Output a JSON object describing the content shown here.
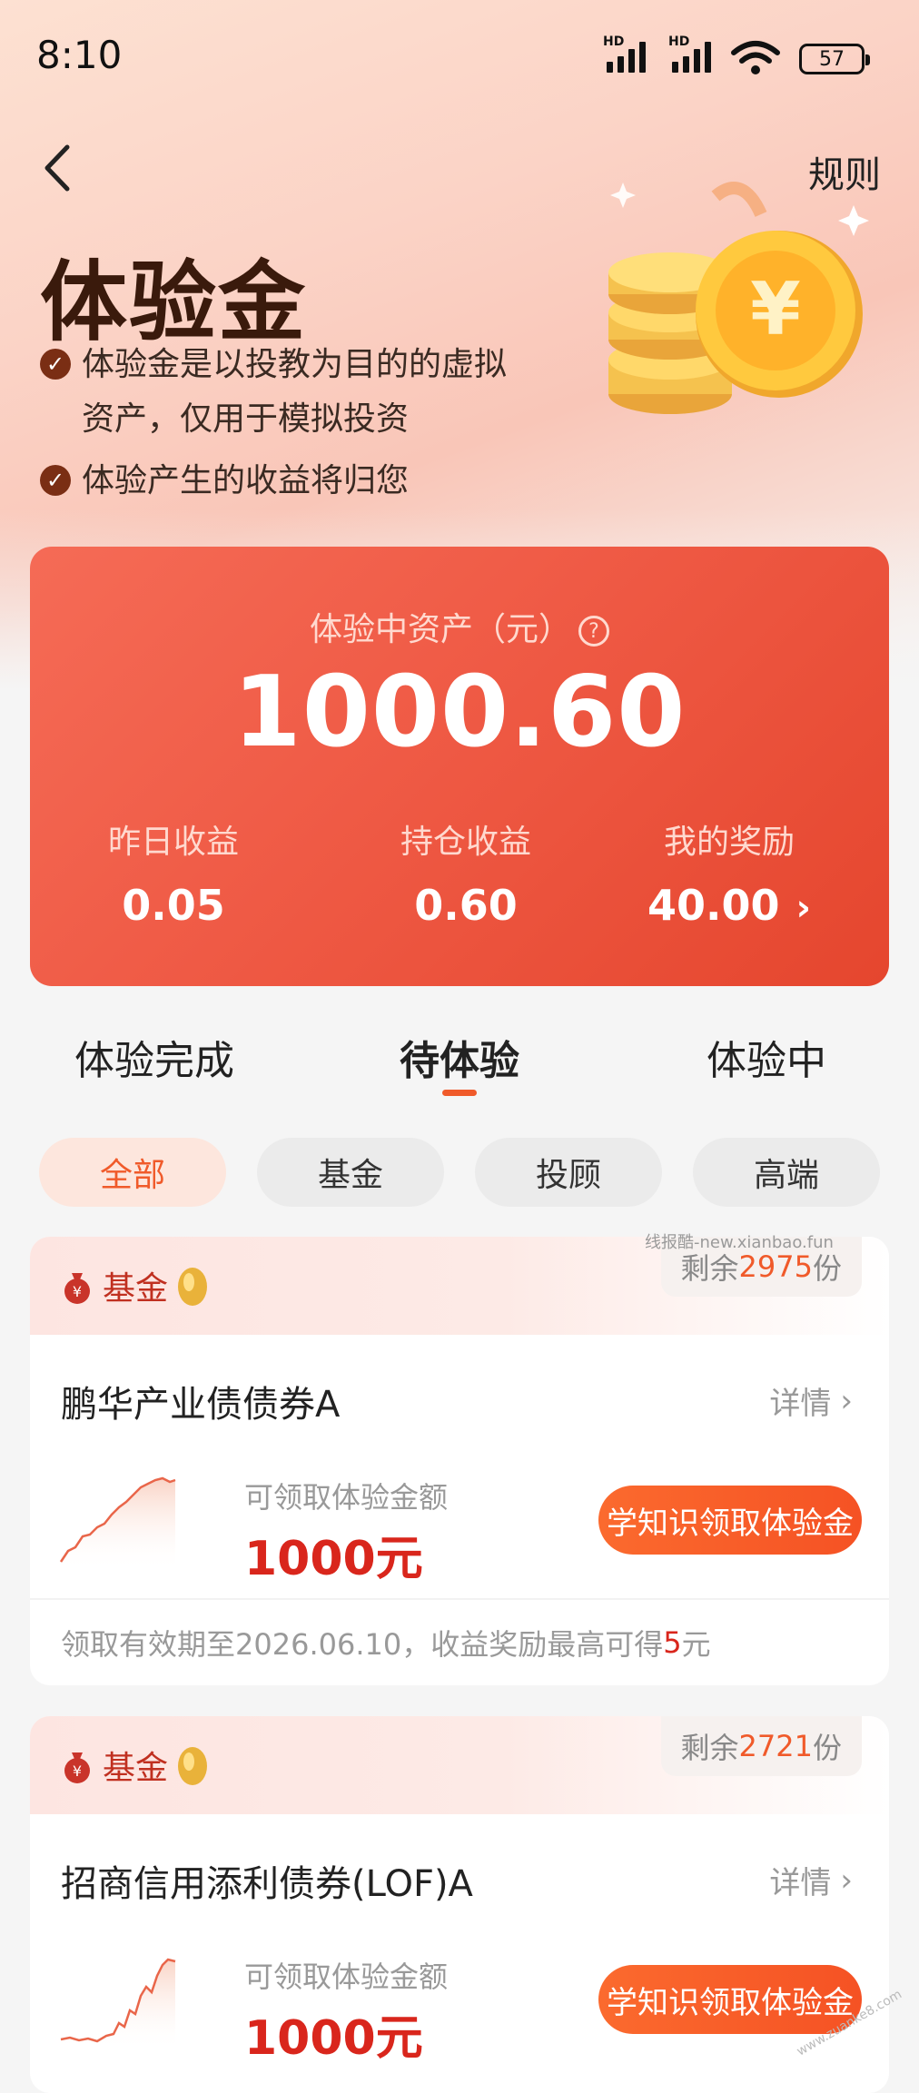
{
  "status": {
    "time": "8:10",
    "battery": "57",
    "hd1": "HD",
    "hd2": "HD"
  },
  "header": {
    "rules": "规则"
  },
  "hero": {
    "title": "体验金",
    "bullets": [
      "体验金是以投教为目的的虚拟",
      "资产，仅用于模拟投资",
      "体验产生的收益将归您"
    ]
  },
  "asset": {
    "label": "体验中资产（元）",
    "help": "?",
    "value": "1000.60",
    "stats": [
      {
        "label": "昨日收益",
        "value": "0.05"
      },
      {
        "label": "持仓收益",
        "value": "0.60"
      },
      {
        "label": "我的奖励",
        "value": "40.00"
      }
    ]
  },
  "tabs": [
    {
      "label": "体验完成"
    },
    {
      "label": "待体验",
      "active": true
    },
    {
      "label": "体验中"
    }
  ],
  "filters": [
    {
      "label": "全部",
      "active": true
    },
    {
      "label": "基金"
    },
    {
      "label": "投顾"
    },
    {
      "label": "高端"
    }
  ],
  "funds": [
    {
      "tag": "基金",
      "remain_prefix": "剩余",
      "remain_count": "2975",
      "remain_suffix": "份",
      "name": "鹏华产业债债券A",
      "detail": "详情",
      "claim_label": "可领取体验金额",
      "claim_value": "1000元",
      "button": "学知识领取体验金",
      "foot_prefix": "领取有效期至2026.06.10，收益奖励最高可得",
      "foot_amount": "5",
      "foot_suffix": "元"
    },
    {
      "tag": "基金",
      "remain_prefix": "剩余",
      "remain_count": "2721",
      "remain_suffix": "份",
      "name": "招商信用添利债券(LOF)A",
      "detail": "详情",
      "claim_label": "可领取体验金额",
      "claim_value": "1000元",
      "button": "学知识领取体验金"
    }
  ],
  "watermark": "线报酷-new.xianbao.fun",
  "watermark2": "www.zuanke8.com",
  "colors": {
    "accent": "#f05a2a",
    "card_gradient_start": "#f56b56",
    "card_gradient_end": "#e5462e",
    "amount_red": "#d9261c"
  }
}
